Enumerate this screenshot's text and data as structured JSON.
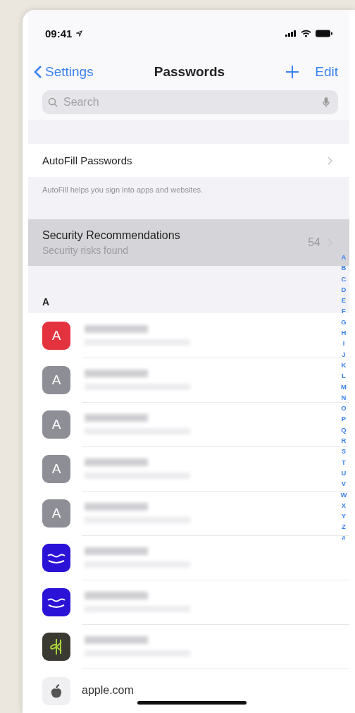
{
  "status_bar": {
    "time": "09:41"
  },
  "nav": {
    "back": "Settings",
    "title": "Passwords",
    "edit": "Edit"
  },
  "search": {
    "placeholder": "Search"
  },
  "autofill": {
    "label": "AutoFill Passwords",
    "footer": "AutoFill helps you sign into apps and websites."
  },
  "security": {
    "title": "Security Recommendations",
    "subtitle": "Security risks found",
    "count": "54",
    "highlighted": true
  },
  "section": {
    "header": "A"
  },
  "accounts": [
    {
      "kind": "monogram",
      "monogram": "A",
      "color": "#e5323f"
    },
    {
      "kind": "monogram",
      "monogram": "A",
      "color": "#8e8e96"
    },
    {
      "kind": "monogram",
      "monogram": "A",
      "color": "#8e8e96"
    },
    {
      "kind": "monogram",
      "monogram": "A",
      "color": "#8e8e96"
    },
    {
      "kind": "monogram",
      "monogram": "A",
      "color": "#8e8e96"
    },
    {
      "kind": "music",
      "color": "#2a13d6"
    },
    {
      "kind": "music",
      "color": "#2a13d6"
    },
    {
      "kind": "leaf",
      "color": "#3a3a33"
    },
    {
      "kind": "apple",
      "site": "apple.com",
      "color": "#f0f0f2"
    }
  ],
  "index": [
    "A",
    "B",
    "C",
    "D",
    "E",
    "F",
    "G",
    "H",
    "I",
    "J",
    "K",
    "L",
    "M",
    "N",
    "O",
    "P",
    "Q",
    "R",
    "S",
    "T",
    "U",
    "V",
    "W",
    "X",
    "Y",
    "Z",
    "#"
  ]
}
